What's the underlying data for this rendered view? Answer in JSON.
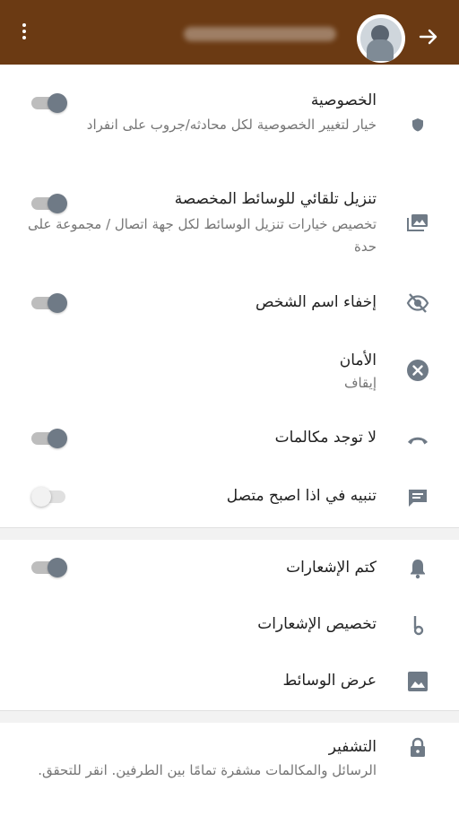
{
  "header": {
    "name_blurred": "",
    "menu_icon": "more-vert-icon",
    "back_icon": "arrow-forward-icon"
  },
  "settings": {
    "privacy": {
      "title": "الخصوصية",
      "subtitle": "خيار لتغيير الخصوصية لكل محادثه/جروب على انفراد",
      "icon": "shield-icon",
      "toggle_on": true
    },
    "auto_download": {
      "title": "تنزيل تلقائي للوسائط المخصصة",
      "subtitle": "تخصيص خيارات تنزيل الوسائط لكل جهة اتصال / مجموعة على حدة",
      "icon": "photo-library-icon",
      "toggle_on": true
    },
    "hide_name": {
      "title": "إخفاء اسم الشخص",
      "icon": "eye-off-icon",
      "toggle_on": true
    },
    "security": {
      "title": "الأمان",
      "subtitle": "إيقاف",
      "icon": "cancel-icon"
    },
    "no_calls": {
      "title": "لا توجد مكالمات",
      "icon": "call-end-icon",
      "toggle_on": true
    },
    "online_alert": {
      "title": "تنبيه في اذا اصبح متصل",
      "icon": "message-icon",
      "toggle_on": false
    },
    "mute_notifications": {
      "title": "كتم الإشعارات",
      "icon": "bell-icon",
      "toggle_on": true
    },
    "custom_notifications": {
      "title": "تخصيص الإشعارات",
      "icon": "music-note-icon"
    },
    "media_visibility": {
      "title": "عرض الوسائط",
      "icon": "image-icon"
    },
    "encryption": {
      "title": "التشفير",
      "subtitle": "الرسائل والمكالمات مشفرة تمامًا بين الطرفين. انقر للتحقق.",
      "icon": "lock-icon"
    }
  },
  "colors": {
    "header": "#6b3a13",
    "icon": "#6f7a86",
    "toggle_thumb_on": "#6f7a86"
  }
}
